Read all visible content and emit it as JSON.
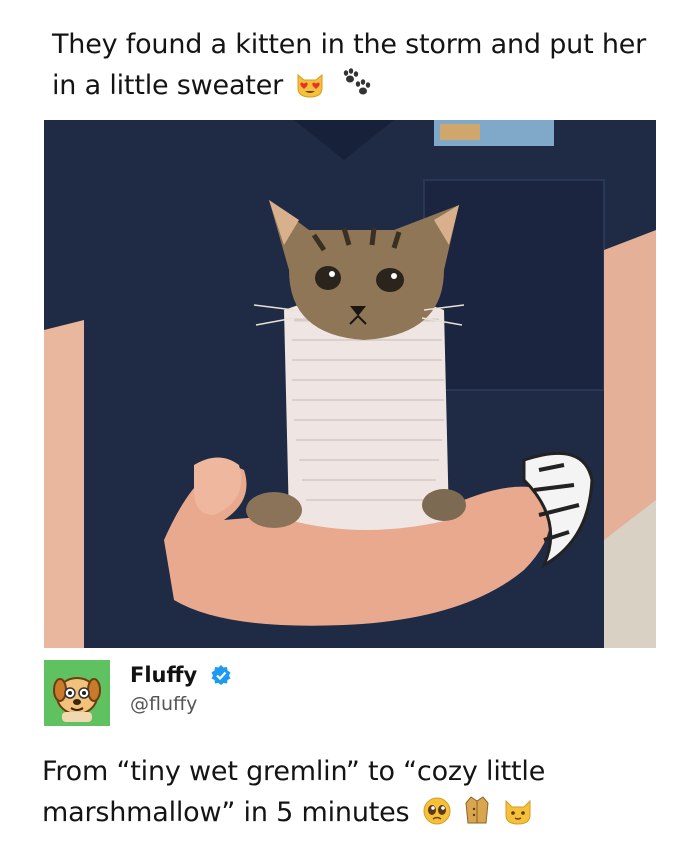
{
  "post": {
    "caption": "They found a kitten in the storm and put her in a little sweater",
    "caption_emojis": [
      "heart-eyes-cat-emoji",
      "paw-prints-emoji"
    ]
  },
  "photo": {
    "description_icon": "kitten-in-sweater-photo"
  },
  "tweet": {
    "display_name": "Fluffy",
    "handle": "@fluffy",
    "verified": true,
    "text": "From “tiny wet gremlin” to “cozy little marshmallow” in 5 minutes",
    "text_emojis": [
      "pleading-face-emoji",
      "coat-emoji",
      "cat-face-emoji"
    ]
  },
  "colors": {
    "avatar_bg": "#5fc15f",
    "verified_badge": "#1d9bf0",
    "scrubs": "#1c2438"
  }
}
